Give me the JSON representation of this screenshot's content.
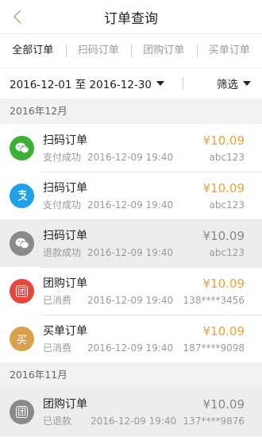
{
  "header": {
    "title": "订单查询"
  },
  "tabs": [
    {
      "label": "全部订单"
    },
    {
      "label": "扫码订单"
    },
    {
      "label": "团购订单"
    },
    {
      "label": "买单订单"
    }
  ],
  "filter": {
    "date_range": "2016-12-01 至 2016-12-30",
    "screen_label": "筛选"
  },
  "sections": [
    {
      "label": "2016年12月",
      "orders": [
        {
          "icon": "wechat-icon",
          "icon_color": "#3cb035",
          "title": "扫码订单",
          "status": "支付成功",
          "time": "2016-12-09 19:40",
          "amount": "¥10.09",
          "amount_color": "orange",
          "ref": "abc123"
        },
        {
          "icon": "alipay-icon",
          "icon_color": "#1ea1e8",
          "title": "扫码订单",
          "status": "支付成功",
          "time": "2016-12-09 19:40",
          "amount": "¥10.09",
          "amount_color": "orange",
          "ref": "abc123"
        },
        {
          "icon": "wechat-icon",
          "icon_color": "#8a8a8a",
          "title": "扫码订单",
          "status": "退款成功",
          "time": "2016-12-09 19:40",
          "amount": "¥10.09",
          "amount_color": "grey",
          "ref": "abc123"
        },
        {
          "icon": "groupbuy-icon",
          "icon_color": "#e8453c",
          "title": "团购订单",
          "status": "已消费",
          "time": "2016-12-09 19:40",
          "amount": "¥10.09",
          "amount_color": "orange",
          "ref": "138****3456"
        },
        {
          "icon": "pay-bill-icon",
          "icon_color": "#d9a14c",
          "title": "买单订单",
          "status": "已消费",
          "time": "2016-12-09 19:40",
          "amount": "¥10.09",
          "amount_color": "orange",
          "ref": "187****9098"
        }
      ]
    },
    {
      "label": "2016年11月",
      "orders": [
        {
          "icon": "groupbuy-icon",
          "icon_color": "#8a8a8a",
          "title": "团购订单",
          "status": "已退款",
          "time": "2016-12-09 19:40",
          "amount": "¥10.09",
          "amount_color": "grey",
          "ref": "137****9876"
        }
      ]
    }
  ],
  "icon_glyphs": {
    "groupbuy": "团",
    "pay_bill": "买"
  },
  "colors": {
    "accent_orange": "#e8a33a",
    "wechat_green": "#3cb035",
    "alipay_blue": "#1ea1e8",
    "groupbuy_red": "#e8453c",
    "pay_bill_gold": "#d9a14c",
    "inactive_grey": "#8a8a8a"
  }
}
